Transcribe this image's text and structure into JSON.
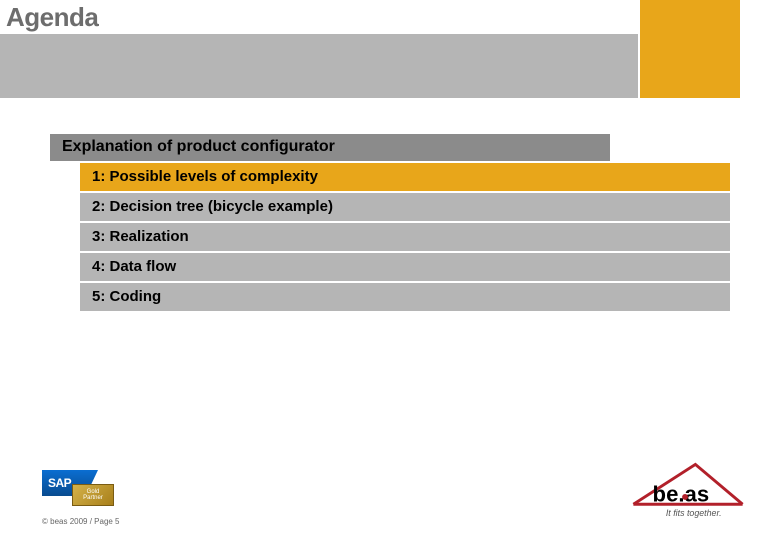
{
  "title": "Agenda",
  "section_title": "Explanation of product configurator",
  "items": [
    {
      "label": "1: Possible levels of complexity",
      "active": true
    },
    {
      "label": "2: Decision tree (bicycle example)",
      "active": false
    },
    {
      "label": "3: Realization",
      "active": false
    },
    {
      "label": "4: Data flow",
      "active": false
    },
    {
      "label": "5: Coding",
      "active": false
    }
  ],
  "sap_logo_text": "SAP",
  "partner_line1": "Gold",
  "partner_line2": "Partner",
  "beas_name": "be.as",
  "beas_tagline": "It fits together.",
  "copyright": "© beas 2009 / Page 5"
}
